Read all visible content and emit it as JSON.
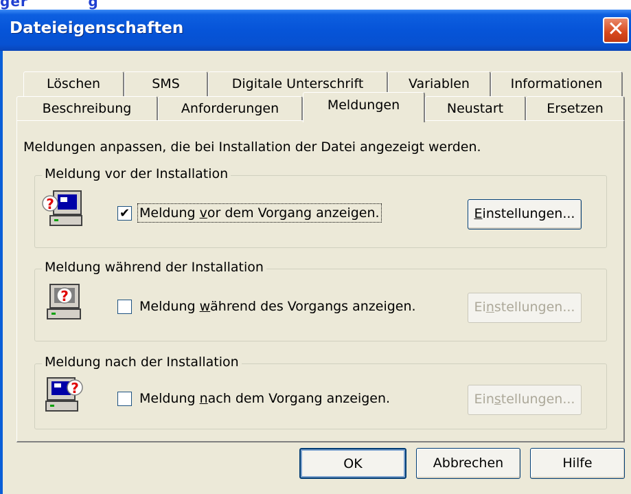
{
  "window": {
    "title": "Dateieigenschaften"
  },
  "tabs_row1": [
    "Löschen",
    "SMS",
    "Digitale Unterschrift",
    "Variablen",
    "Informationen"
  ],
  "tabs_row2": [
    "Beschreibung",
    "Anforderungen",
    "Meldungen",
    "Neustart",
    "Ersetzen"
  ],
  "active_tab": "Meldungen",
  "panel": {
    "intro": "Meldungen anpassen, die bei Installation der Datei angezeigt werden."
  },
  "groups": [
    {
      "legend": "Meldung vor der Installation",
      "checkbox_checked": true,
      "label_pre": "Meldung ",
      "label_key": "v",
      "label_post": "or dem Vorgang anzeigen.",
      "button_key": "E",
      "button_rest": "instellungen...",
      "button_enabled": true,
      "icon": "computer-question-icon"
    },
    {
      "legend": "Meldung während der Installation",
      "checkbox_checked": false,
      "label_pre": "Meldung ",
      "label_key": "w",
      "label_post": "ährend des Vorgangs anzeigen.",
      "button_pre": "Ei",
      "button_key": "n",
      "button_rest": "stellungen...",
      "button_enabled": false,
      "icon": "computer-question-icon"
    },
    {
      "legend": "Meldung nach der Installation",
      "checkbox_checked": false,
      "label_pre": "Meldung ",
      "label_key": "n",
      "label_post": "ach dem Vorgang anzeigen.",
      "button_pre": "Ein",
      "button_key": "s",
      "button_rest": "tellungen...",
      "button_enabled": false,
      "icon": "computer-question-icon"
    }
  ],
  "buttons": {
    "ok": "OK",
    "cancel": "Abbrechen",
    "help": "Hilfe"
  },
  "colors": {
    "titlebar": "#0654d8",
    "face": "#ece9d8",
    "close": "#d8481c"
  }
}
